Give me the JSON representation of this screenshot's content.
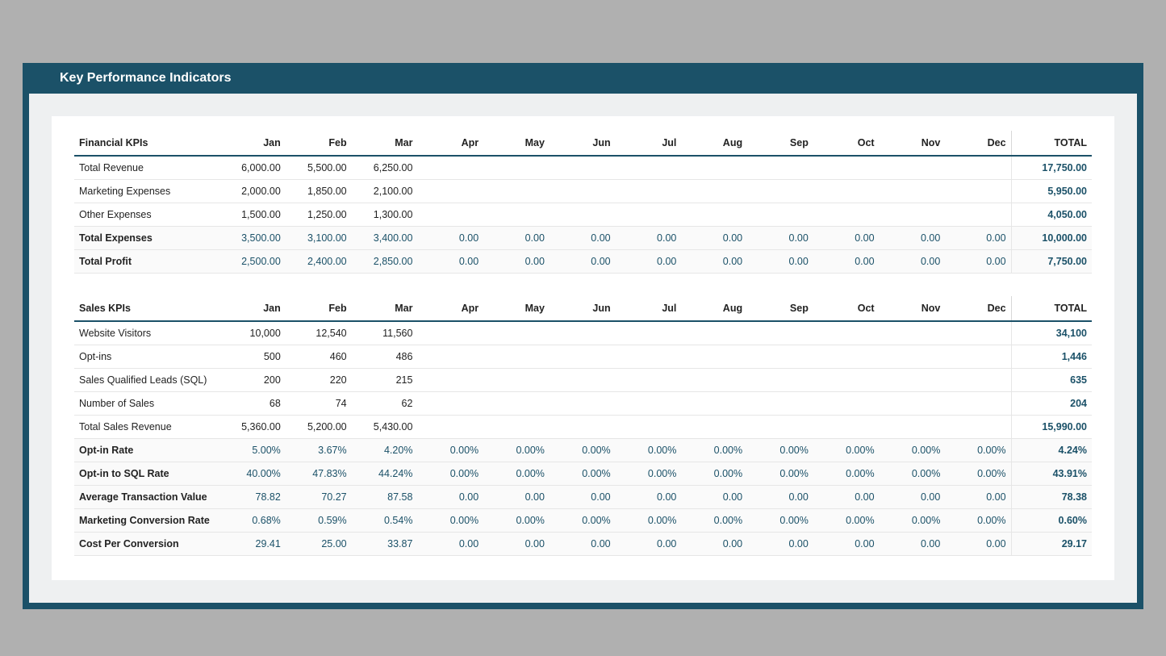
{
  "title": "Key Performance Indicators",
  "months": [
    "Jan",
    "Feb",
    "Mar",
    "Apr",
    "May",
    "Jun",
    "Jul",
    "Aug",
    "Sep",
    "Oct",
    "Nov",
    "Dec"
  ],
  "total_label": "TOTAL",
  "sections": [
    {
      "header": "Financial KPIs",
      "rows": [
        {
          "label": "Total Revenue",
          "calc": false,
          "values": [
            "6,000.00",
            "5,500.00",
            "6,250.00",
            "",
            "",
            "",
            "",
            "",
            "",
            "",
            "",
            ""
          ],
          "total": "17,750.00"
        },
        {
          "label": "Marketing Expenses",
          "calc": false,
          "values": [
            "2,000.00",
            "1,850.00",
            "2,100.00",
            "",
            "",
            "",
            "",
            "",
            "",
            "",
            "",
            ""
          ],
          "total": "5,950.00"
        },
        {
          "label": "Other Expenses",
          "calc": false,
          "values": [
            "1,500.00",
            "1,250.00",
            "1,300.00",
            "",
            "",
            "",
            "",
            "",
            "",
            "",
            "",
            ""
          ],
          "total": "4,050.00"
        },
        {
          "label": "Total Expenses",
          "calc": true,
          "values": [
            "3,500.00",
            "3,100.00",
            "3,400.00",
            "0.00",
            "0.00",
            "0.00",
            "0.00",
            "0.00",
            "0.00",
            "0.00",
            "0.00",
            "0.00"
          ],
          "total": "10,000.00"
        },
        {
          "label": "Total Profit",
          "calc": true,
          "values": [
            "2,500.00",
            "2,400.00",
            "2,850.00",
            "0.00",
            "0.00",
            "0.00",
            "0.00",
            "0.00",
            "0.00",
            "0.00",
            "0.00",
            "0.00"
          ],
          "total": "7,750.00"
        }
      ]
    },
    {
      "header": "Sales KPIs",
      "rows": [
        {
          "label": "Website Visitors",
          "calc": false,
          "values": [
            "10,000",
            "12,540",
            "11,560",
            "",
            "",
            "",
            "",
            "",
            "",
            "",
            "",
            ""
          ],
          "total": "34,100"
        },
        {
          "label": "Opt-ins",
          "calc": false,
          "values": [
            "500",
            "460",
            "486",
            "",
            "",
            "",
            "",
            "",
            "",
            "",
            "",
            ""
          ],
          "total": "1,446"
        },
        {
          "label": "Sales Qualified Leads (SQL)",
          "calc": false,
          "values": [
            "200",
            "220",
            "215",
            "",
            "",
            "",
            "",
            "",
            "",
            "",
            "",
            ""
          ],
          "total": "635"
        },
        {
          "label": "Number of Sales",
          "calc": false,
          "values": [
            "68",
            "74",
            "62",
            "",
            "",
            "",
            "",
            "",
            "",
            "",
            "",
            ""
          ],
          "total": "204"
        },
        {
          "label": "Total Sales Revenue",
          "calc": false,
          "values": [
            "5,360.00",
            "5,200.00",
            "5,430.00",
            "",
            "",
            "",
            "",
            "",
            "",
            "",
            "",
            ""
          ],
          "total": "15,990.00"
        },
        {
          "label": "Opt-in Rate",
          "calc": true,
          "values": [
            "5.00%",
            "3.67%",
            "4.20%",
            "0.00%",
            "0.00%",
            "0.00%",
            "0.00%",
            "0.00%",
            "0.00%",
            "0.00%",
            "0.00%",
            "0.00%"
          ],
          "total": "4.24%"
        },
        {
          "label": "Opt-in to SQL Rate",
          "calc": true,
          "values": [
            "40.00%",
            "47.83%",
            "44.24%",
            "0.00%",
            "0.00%",
            "0.00%",
            "0.00%",
            "0.00%",
            "0.00%",
            "0.00%",
            "0.00%",
            "0.00%"
          ],
          "total": "43.91%"
        },
        {
          "label": "Average Transaction Value",
          "calc": true,
          "values": [
            "78.82",
            "70.27",
            "87.58",
            "0.00",
            "0.00",
            "0.00",
            "0.00",
            "0.00",
            "0.00",
            "0.00",
            "0.00",
            "0.00"
          ],
          "total": "78.38"
        },
        {
          "label": "Marketing Conversion Rate",
          "calc": true,
          "values": [
            "0.68%",
            "0.59%",
            "0.54%",
            "0.00%",
            "0.00%",
            "0.00%",
            "0.00%",
            "0.00%",
            "0.00%",
            "0.00%",
            "0.00%",
            "0.00%"
          ],
          "total": "0.60%"
        },
        {
          "label": "Cost Per Conversion",
          "calc": true,
          "values": [
            "29.41",
            "25.00",
            "33.87",
            "0.00",
            "0.00",
            "0.00",
            "0.00",
            "0.00",
            "0.00",
            "0.00",
            "0.00",
            "0.00"
          ],
          "total": "29.17"
        }
      ]
    }
  ]
}
